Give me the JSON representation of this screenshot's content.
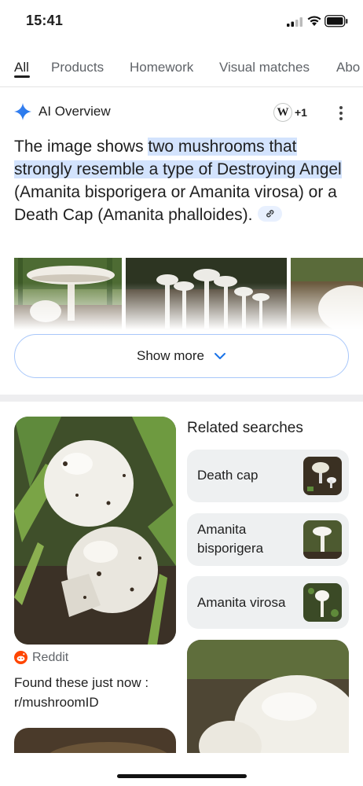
{
  "status": {
    "time": "15:41"
  },
  "tabs": [
    {
      "label": "All",
      "active": true
    },
    {
      "label": "Products"
    },
    {
      "label": "Homework"
    },
    {
      "label": "Visual matches"
    },
    {
      "label": "Abo"
    }
  ],
  "ai_overview": {
    "title": "AI Overview",
    "source_badge": "W",
    "source_count": "+1",
    "text_before": "The image shows ",
    "text_highlight": "two mushrooms that strongly resemble a type of Destroying Angel",
    "text_after": " (Amanita bisporigera or Amanita virosa) or a Death Cap (Amanita phalloides).",
    "show_more_label": "Show more",
    "highlight_color": "#d3e3fd"
  },
  "result": {
    "source": "Reddit",
    "title": "Found these just now : r/mushroomID"
  },
  "related": {
    "title": "Related searches",
    "items": [
      {
        "label": "Death cap"
      },
      {
        "label": "Amanita bisporigera"
      },
      {
        "label": "Amanita virosa"
      }
    ]
  },
  "colors": {
    "accent": "#1a73e8",
    "reddit": "#ff4500",
    "chip_bg": "#eef0f1"
  }
}
